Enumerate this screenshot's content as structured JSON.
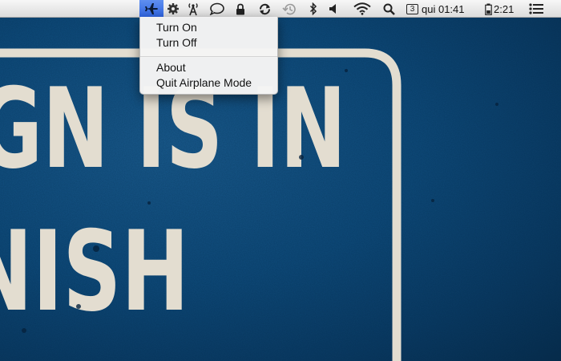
{
  "menubar": {
    "icons": [
      {
        "name": "airplane-icon",
        "active": true
      },
      {
        "name": "gear-icon"
      },
      {
        "name": "antenna-icon"
      },
      {
        "name": "chat-bubble-icon"
      },
      {
        "name": "lock-icon"
      },
      {
        "name": "sync-icon"
      },
      {
        "name": "time-machine-icon"
      },
      {
        "name": "bluetooth-icon"
      },
      {
        "name": "volume-icon"
      },
      {
        "name": "wifi-icon"
      },
      {
        "name": "spotlight-search-icon"
      },
      {
        "name": "battery-icon"
      },
      {
        "name": "notification-list-icon"
      }
    ],
    "space_number": "3",
    "clock": "qui 01:41",
    "battery_time": "2:21"
  },
  "airplane_menu": {
    "items": [
      {
        "label": "Turn On"
      },
      {
        "label": "Turn Off"
      },
      {
        "label": "About"
      },
      {
        "label": "Quit Airplane Mode"
      }
    ]
  },
  "wallpaper": {
    "sign_line_1": "GN IS IN",
    "sign_line_2": "NISH"
  },
  "colors": {
    "menubar_active": "#3a6fe6",
    "wallpaper_blue": "#0e4a7a",
    "sign_paint": "#e3ddd0"
  }
}
